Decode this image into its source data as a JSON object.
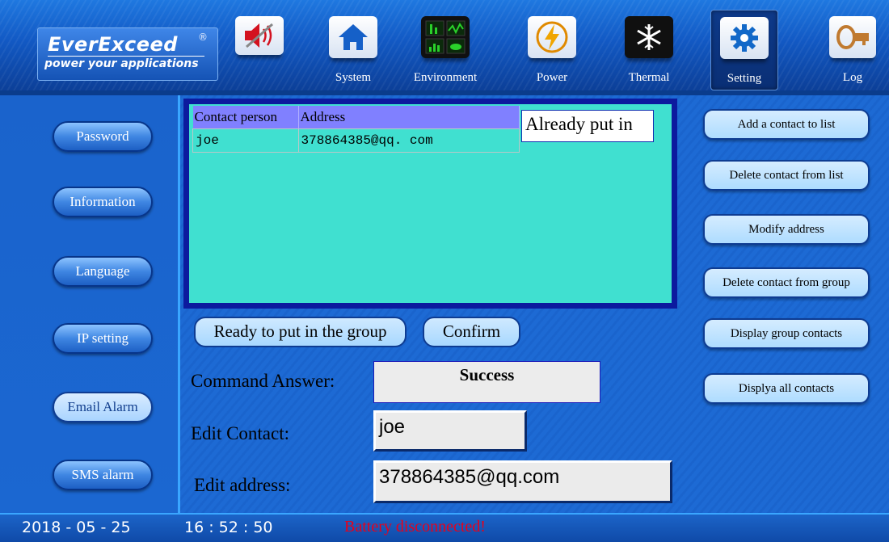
{
  "header": {
    "brand": "EverExceed",
    "registered": "®",
    "tagline": "power your applications",
    "nav": [
      {
        "label": "",
        "icon": "mute-speaker-icon"
      },
      {
        "label": "System",
        "icon": "home-icon"
      },
      {
        "label": "Environment",
        "icon": "environment-monitor-icon"
      },
      {
        "label": "Power",
        "icon": "lightning-icon"
      },
      {
        "label": "Thermal",
        "icon": "snowflake-icon"
      },
      {
        "label": "Setting",
        "icon": "gear-icon",
        "active": true
      },
      {
        "label": "Log",
        "icon": "log-key-icon"
      }
    ]
  },
  "sidebar": {
    "items": [
      {
        "label": "Password"
      },
      {
        "label": "Information"
      },
      {
        "label": "Language"
      },
      {
        "label": "IP setting"
      },
      {
        "label": "Email Alarm",
        "selected": true
      },
      {
        "label": "SMS alarm"
      }
    ]
  },
  "contacts": {
    "headers": [
      "Contact person",
      "Address"
    ],
    "rows": [
      {
        "name": "joe",
        "address": "378864385@qq. com"
      }
    ],
    "already_label": "Already put in"
  },
  "actions": [
    "Add a contact to list",
    "Delete contact from list",
    "Modify address",
    "Delete contact from group",
    "Display group contacts",
    "Displya all contacts"
  ],
  "group": {
    "ready_label": "Ready to put in the group",
    "confirm_label": "Confirm"
  },
  "form": {
    "answer_label": "Command Answer:",
    "answer_value": "Success",
    "contact_label": "Edit Contact:",
    "contact_value": "joe",
    "address_label": "Edit address:",
    "address_value": "378864385@qq.com"
  },
  "status": {
    "date": "2018 - 05 - 25",
    "time": "16 : 52 : 50",
    "alert": "Battery disconnected!",
    "alert_color": "#e8001a"
  }
}
